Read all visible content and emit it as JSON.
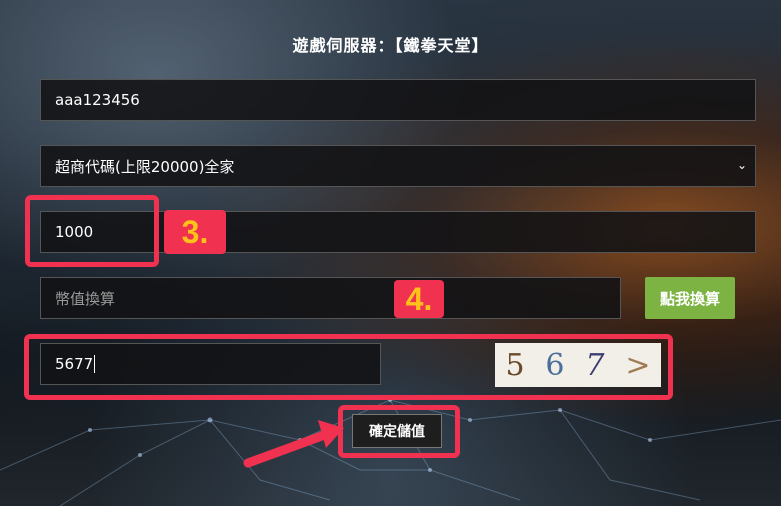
{
  "page": {
    "title": "遊戲伺服器：【鐵拳天堂】"
  },
  "form": {
    "account_value": "aaa123456",
    "payment_selected": "超商代碼(上限20000)全家",
    "amount_value": "1000",
    "conversion_placeholder": "幣值換算",
    "convert_button": "點我換算",
    "captcha_input_value": "5677",
    "captcha_digits": [
      "5",
      "6",
      "7",
      ">"
    ],
    "submit_button": "確定儲值"
  },
  "annotations": {
    "step3_label": "3.",
    "step4_label": "4."
  },
  "colors": {
    "highlight": "#f0314f",
    "tag_text": "#ffc21a",
    "convert_button": "#7cb342"
  }
}
